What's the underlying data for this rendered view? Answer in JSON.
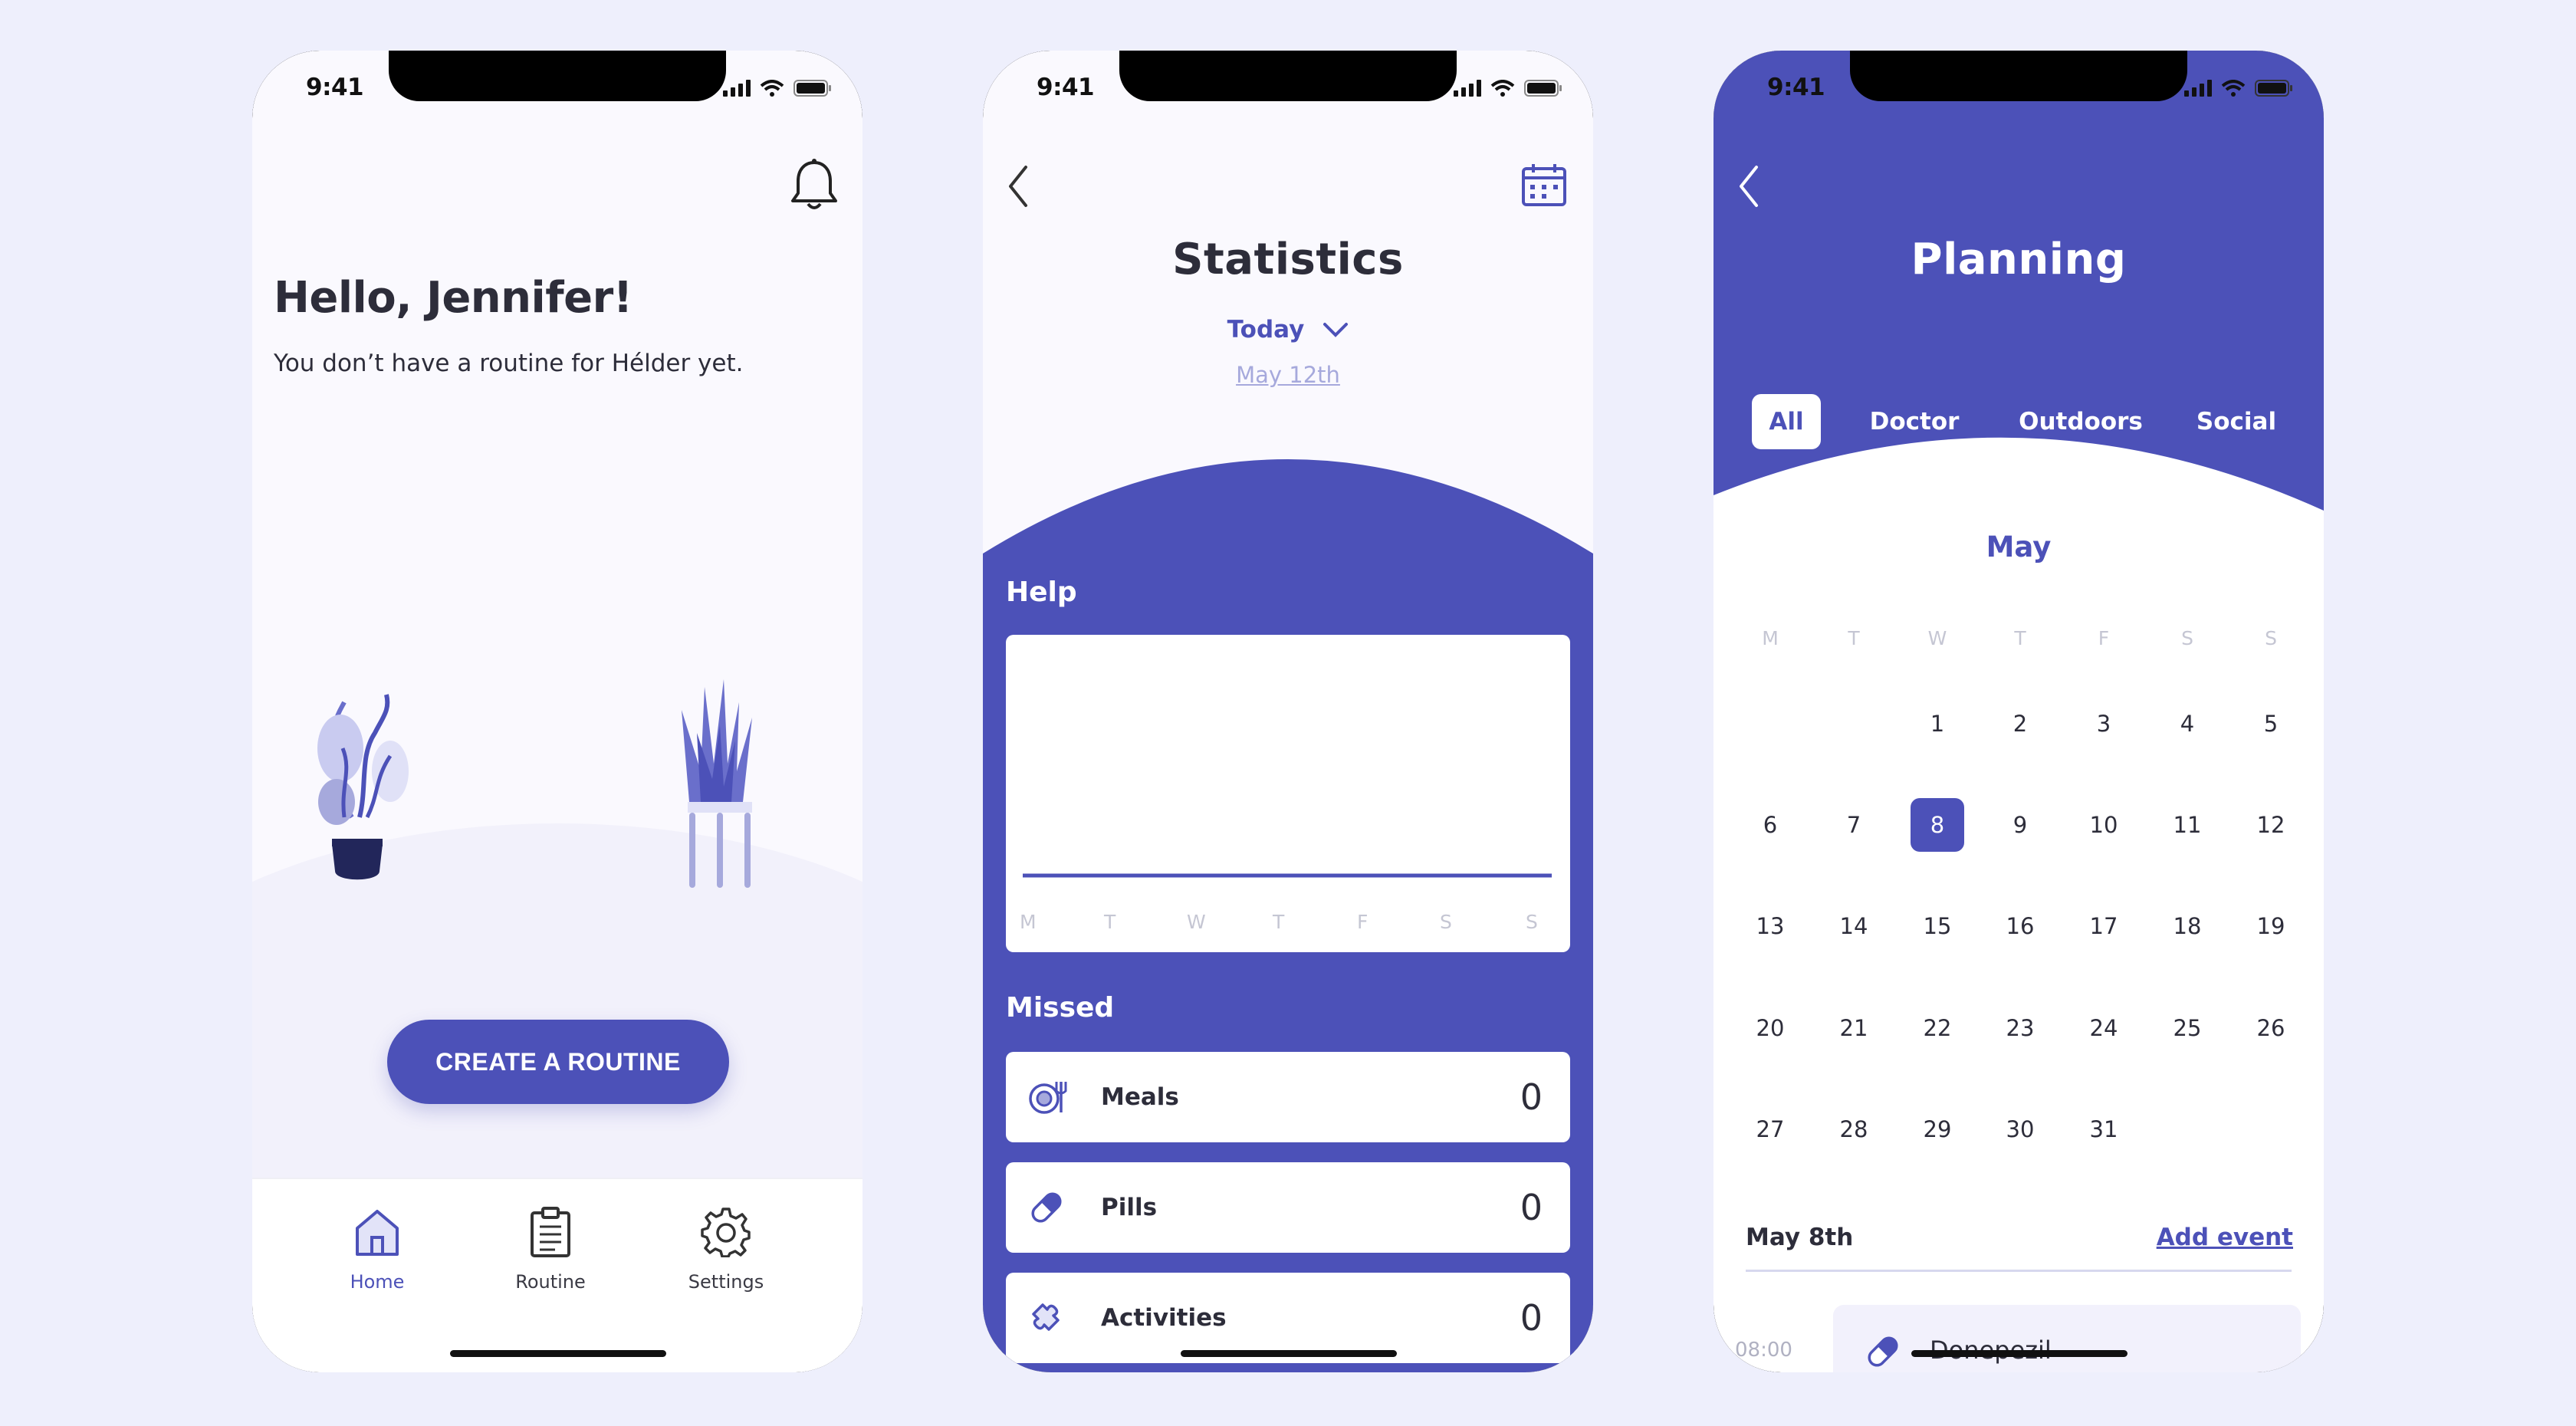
{
  "status_bar": {
    "time": "9:41"
  },
  "home": {
    "greeting": "Hello, Jennifer!",
    "subtext": "You don’t have a routine for Hélder yet.",
    "create_button": "CREATE A ROUTINE",
    "tabs": [
      {
        "label": "Home",
        "icon": "house-icon",
        "active": true
      },
      {
        "label": "Routine",
        "icon": "clipboard-icon",
        "active": false
      },
      {
        "label": "Settings",
        "icon": "gear-icon",
        "active": false
      }
    ]
  },
  "statistics": {
    "title": "Statistics",
    "period": "Today",
    "date": "May 12th",
    "help_label": "Help",
    "chart_days": [
      "M",
      "T",
      "W",
      "T",
      "F",
      "S",
      "S"
    ],
    "missed_label": "Missed",
    "missed": [
      {
        "label": "Meals",
        "count": "0",
        "icon": "plate-icon"
      },
      {
        "label": "Pills",
        "count": "0",
        "icon": "pill-icon"
      },
      {
        "label": "Activities",
        "count": "0",
        "icon": "puzzle-icon"
      }
    ]
  },
  "planning": {
    "title": "Planning",
    "filters": [
      {
        "label": "All",
        "active": true
      },
      {
        "label": "Doctor",
        "active": false
      },
      {
        "label": "Outdoors",
        "active": false
      },
      {
        "label": "Social",
        "active": false
      }
    ],
    "month": "May",
    "weekdays": [
      "M",
      "T",
      "W",
      "T",
      "F",
      "S",
      "S"
    ],
    "weeks": [
      [
        "",
        "",
        "1",
        "2",
        "3",
        "4",
        "5"
      ],
      [
        "6",
        "7",
        "8",
        "9",
        "10",
        "11",
        "12"
      ],
      [
        "13",
        "14",
        "15",
        "16",
        "17",
        "18",
        "19"
      ],
      [
        "20",
        "21",
        "22",
        "23",
        "24",
        "25",
        "26"
      ],
      [
        "27",
        "28",
        "29",
        "30",
        "31",
        "",
        ""
      ]
    ],
    "selected_day": "8",
    "selected_date_label": "May 8th",
    "add_event": "Add event",
    "events": [
      {
        "time": "08:00",
        "name": "Donepezil",
        "icon": "pill-icon"
      }
    ]
  },
  "colors": {
    "accent": "#4C51B8",
    "background": "#EEEFFC",
    "light_accent": "#A6A9DC"
  }
}
